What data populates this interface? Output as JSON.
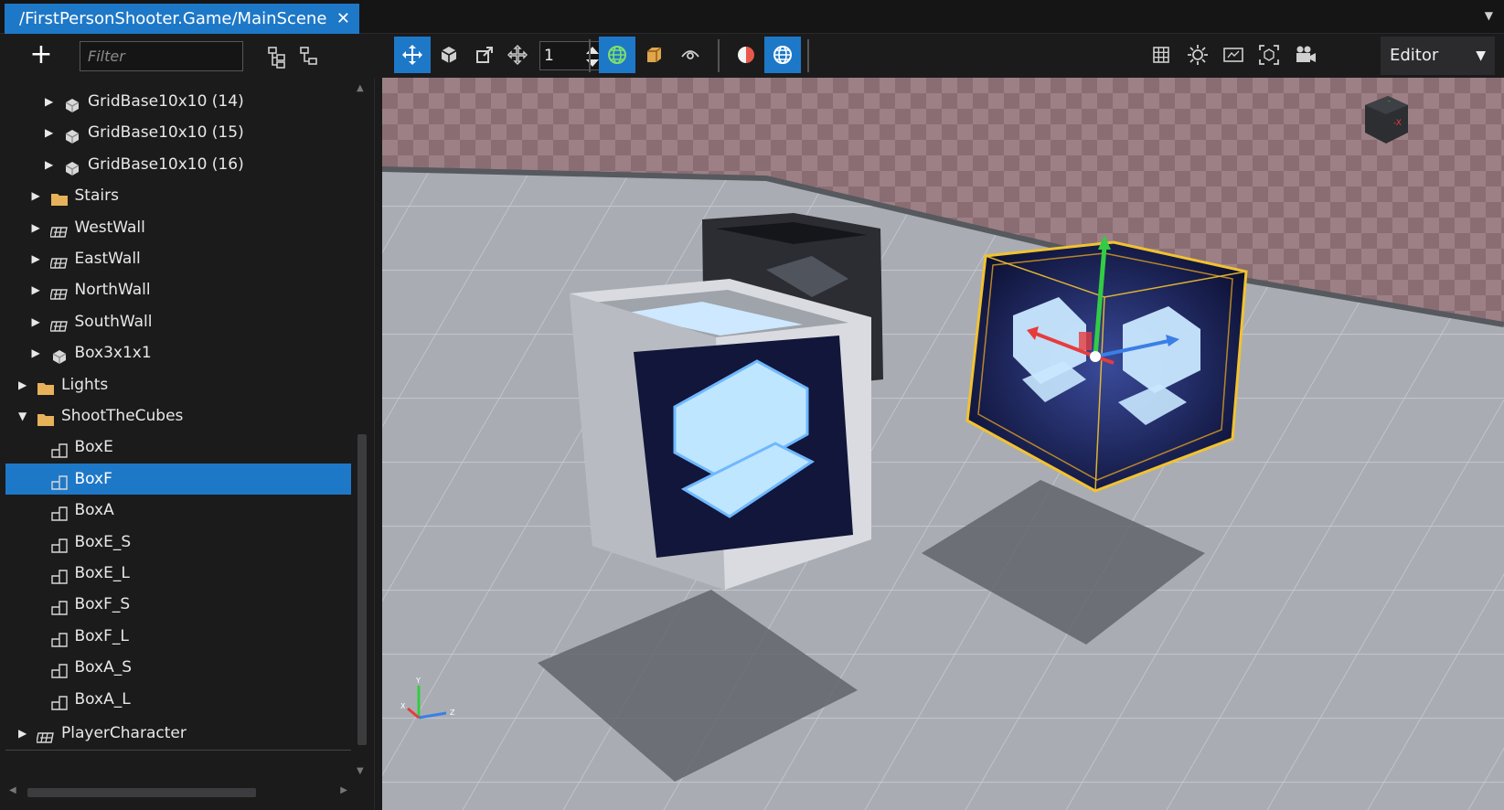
{
  "tab": {
    "title": "/FirstPersonShooter.Game/MainScene",
    "close_glyph": "✕",
    "menu_glyph": "▼"
  },
  "hierarchy": {
    "add_glyph": "+",
    "filter_placeholder": "Filter",
    "filter_value": "",
    "items": [
      {
        "label": "GridBase10x10 (14)",
        "icon": "model-icon",
        "depth": 2,
        "expander": "collapsed",
        "selected": false
      },
      {
        "label": "GridBase10x10 (15)",
        "icon": "model-icon",
        "depth": 2,
        "expander": "collapsed",
        "selected": false
      },
      {
        "label": "GridBase10x10 (16)",
        "icon": "model-icon",
        "depth": 2,
        "expander": "collapsed",
        "selected": false
      },
      {
        "label": "Stairs",
        "icon": "folder-icon",
        "depth": 1,
        "expander": "collapsed",
        "selected": false
      },
      {
        "label": "WestWall",
        "icon": "prefab-icon",
        "depth": 1,
        "expander": "collapsed",
        "selected": false
      },
      {
        "label": "EastWall",
        "icon": "prefab-icon",
        "depth": 1,
        "expander": "collapsed",
        "selected": false
      },
      {
        "label": "NorthWall",
        "icon": "prefab-icon",
        "depth": 1,
        "expander": "collapsed",
        "selected": false
      },
      {
        "label": "SouthWall",
        "icon": "prefab-icon",
        "depth": 1,
        "expander": "collapsed",
        "selected": false
      },
      {
        "label": "Box3x1x1",
        "icon": "model-icon",
        "depth": 1,
        "expander": "collapsed",
        "selected": false
      },
      {
        "label": "Lights",
        "icon": "folder-icon",
        "depth": 0,
        "expander": "collapsed",
        "selected": false
      },
      {
        "label": "ShootTheCubes",
        "icon": "folder-icon",
        "depth": 0,
        "expander": "expanded",
        "selected": false
      },
      {
        "label": "BoxE",
        "icon": "entity-icon",
        "depth": 1,
        "expander": "none",
        "selected": false
      },
      {
        "label": "BoxF",
        "icon": "entity-icon",
        "depth": 1,
        "expander": "none",
        "selected": true
      },
      {
        "label": "BoxA",
        "icon": "entity-icon",
        "depth": 1,
        "expander": "none",
        "selected": false
      },
      {
        "label": "BoxE_S",
        "icon": "entity-icon",
        "depth": 1,
        "expander": "none",
        "selected": false
      },
      {
        "label": "BoxE_L",
        "icon": "entity-icon",
        "depth": 1,
        "expander": "none",
        "selected": false
      },
      {
        "label": "BoxF_S",
        "icon": "entity-icon",
        "depth": 1,
        "expander": "none",
        "selected": false
      },
      {
        "label": "BoxF_L",
        "icon": "entity-icon",
        "depth": 1,
        "expander": "none",
        "selected": false
      },
      {
        "label": "BoxA_S",
        "icon": "entity-icon",
        "depth": 1,
        "expander": "none",
        "selected": false
      },
      {
        "label": "BoxA_L",
        "icon": "entity-icon",
        "depth": 1,
        "expander": "none",
        "selected": false
      },
      {
        "label": "PlayerCharacter",
        "icon": "prefab-icon",
        "depth": 0,
        "expander": "collapsed",
        "selected": false
      }
    ]
  },
  "scene_toolbar": {
    "snap_value": "1",
    "view_mode": "Editor",
    "tools": [
      {
        "name": "translate-tool",
        "icon": "move-icon",
        "active": true
      },
      {
        "name": "rotate-tool",
        "icon": "rotate-icon",
        "active": false
      },
      {
        "name": "scale-tool",
        "icon": "scale-icon",
        "active": false
      },
      {
        "name": "snap-toggle",
        "icon": "snap-icon",
        "active": false
      },
      {
        "name": "world-space-toggle",
        "icon": "globe-icon",
        "active": true
      },
      {
        "name": "local-space-toggle",
        "icon": "cube-icon",
        "active": false
      },
      {
        "name": "camera-orbit-toggle",
        "icon": "eye-icon",
        "active": false
      },
      {
        "name": "lighting-toggle",
        "icon": "shading-icon",
        "active": false
      },
      {
        "name": "navigation-toggle",
        "icon": "globe-icon",
        "active": true
      },
      {
        "name": "grid-toggle",
        "icon": "grid-icon",
        "active": false
      },
      {
        "name": "light-gizmo-toggle",
        "icon": "sun-icon",
        "active": false
      },
      {
        "name": "render-mode-button",
        "icon": "screen-icon",
        "active": false
      },
      {
        "name": "snapshot-button",
        "icon": "frame-icon",
        "active": false
      },
      {
        "name": "camera-settings-button",
        "icon": "camera-icon",
        "active": false
      }
    ]
  },
  "colors": {
    "accent": "#1e78c8",
    "panel": "#1b1b1c",
    "selection_wire": "#f2c230",
    "axis_x": "#e63c3c",
    "axis_y": "#33cc44",
    "axis_z": "#3a7fe6",
    "cube_glow": "#bfe6ff"
  },
  "viewport": {
    "axis_labels": {
      "y": "Y",
      "x": "X",
      "z": "Z"
    }
  }
}
